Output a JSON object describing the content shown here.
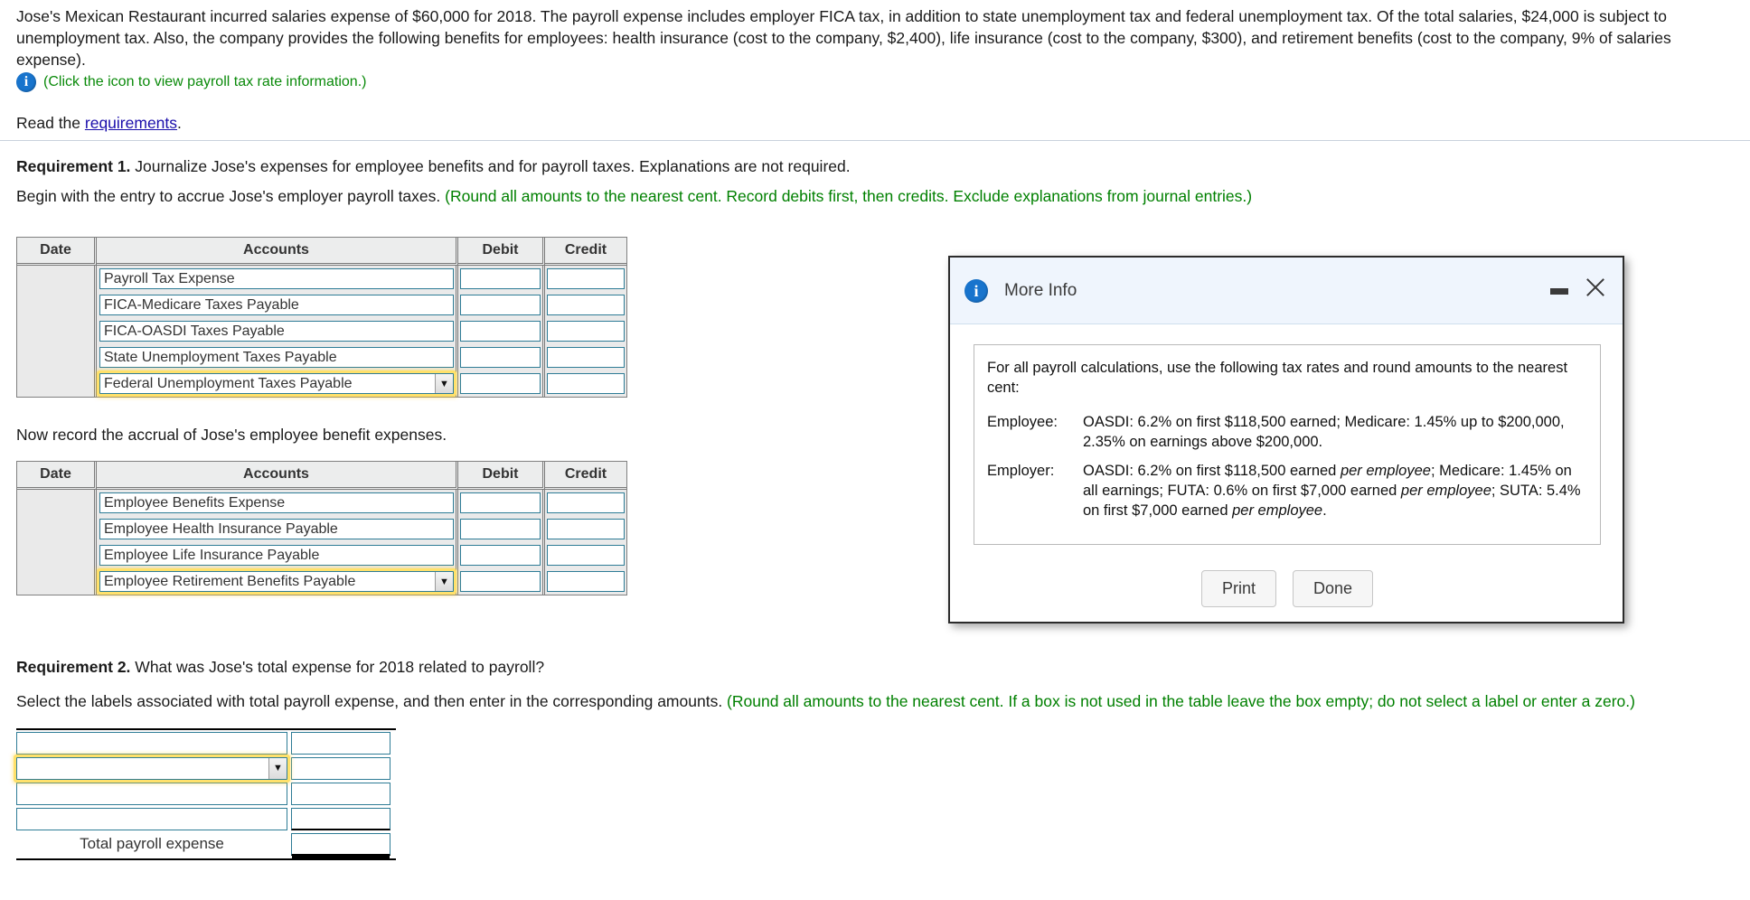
{
  "intro": {
    "paragraph": "Jose's Mexican Restaurant incurred salaries expense of $60,000 for 2018. The payroll expense includes employer FICA tax, in addition to state unemployment tax and federal unemployment tax. Of the total salaries, $24,000 is subject to unemployment tax. Also, the company provides the following benefits for employees: health insurance (cost to the company, $2,400), life insurance (cost to the company, $300), and retirement benefits (cost to the company, 9% of salaries expense).",
    "icon_note": "(Click the icon to view payroll tax rate information.)",
    "info_icon": "info-icon",
    "read_prefix": "Read the ",
    "read_link": "requirements",
    "read_suffix": "."
  },
  "requirement1": {
    "label": "Requirement 1.",
    "text": " Journalize Jose's expenses for employee benefits and for payroll taxes. Explanations are not required.",
    "instruction_black": "Begin with the entry to accrue Jose's employer payroll taxes. ",
    "instruction_green": "(Round all amounts to the nearest cent. Record debits first, then credits. Exclude explanations from journal entries.)",
    "second_instruction": "Now record the accrual of Jose's employee benefit expenses."
  },
  "journal_headers": {
    "date": "Date",
    "accounts": "Accounts",
    "debit": "Debit",
    "credit": "Credit"
  },
  "journal1": {
    "rows": [
      {
        "account": "Payroll Tax Expense",
        "debit": "",
        "credit": "",
        "type": "text",
        "focused": false
      },
      {
        "account": "FICA-Medicare Taxes Payable",
        "debit": "",
        "credit": "",
        "type": "text",
        "focused": false
      },
      {
        "account": "FICA-OASDI Taxes Payable",
        "debit": "",
        "credit": "",
        "type": "text",
        "focused": false
      },
      {
        "account": "State Unemployment Taxes Payable",
        "debit": "",
        "credit": "",
        "type": "text",
        "focused": false
      },
      {
        "account": "Federal Unemployment Taxes Payable",
        "debit": "",
        "credit": "",
        "type": "select",
        "focused": true
      }
    ]
  },
  "journal2": {
    "rows": [
      {
        "account": "Employee Benefits Expense",
        "debit": "",
        "credit": "",
        "type": "text",
        "focused": false
      },
      {
        "account": "Employee Health Insurance Payable",
        "debit": "",
        "credit": "",
        "type": "text",
        "focused": false
      },
      {
        "account": "Employee Life Insurance Payable",
        "debit": "",
        "credit": "",
        "type": "text",
        "focused": false
      },
      {
        "account": "Employee Retirement Benefits Payable",
        "debit": "",
        "credit": "",
        "type": "select",
        "focused": true
      }
    ]
  },
  "requirement2": {
    "label": "Requirement 2.",
    "text": " What was Jose's total expense for 2018 related to payroll?",
    "instruction_black": "Select the labels associated with total payroll expense, and then enter in the corresponding amounts. ",
    "instruction_green": "(Round all amounts to the nearest cent. If a box is not used in the table leave the box empty; do not select a label or enter a zero.)",
    "rows": [
      {
        "label": "",
        "amount": "",
        "type": "text",
        "focused": false,
        "rule": "none"
      },
      {
        "label": "",
        "amount": "",
        "type": "select",
        "focused": true,
        "rule": "none"
      },
      {
        "label": "",
        "amount": "",
        "type": "text",
        "focused": false,
        "rule": "none"
      },
      {
        "label": "",
        "amount": "",
        "type": "text",
        "focused": false,
        "rule": "single"
      }
    ],
    "total_label": "Total payroll expense",
    "total_amount": ""
  },
  "modal": {
    "title": "More Info",
    "info_icon": "info-icon",
    "minimize_icon": "minimize-icon",
    "close_icon": "close-icon",
    "lead": "For all payroll calculations, use the following tax rates and round amounts to the nearest cent:",
    "rates": [
      {
        "key": "Employee:",
        "parts": [
          {
            "text": "OASDI: 6.2% on first $118,500 earned; Medicare: 1.45% up to $200,000, 2.35% on earnings above $200,000.",
            "italic": false
          }
        ]
      },
      {
        "key": "Employer:",
        "parts": [
          {
            "text": "OASDI: 6.2% on first $118,500 earned ",
            "italic": false
          },
          {
            "text": "per employee",
            "italic": true
          },
          {
            "text": "; Medicare: 1.45% on all earnings; FUTA: 0.6% on first $7,000 earned ",
            "italic": false
          },
          {
            "text": "per employee",
            "italic": true
          },
          {
            "text": "; SUTA: 5.4% on first $7,000 earned ",
            "italic": false
          },
          {
            "text": "per employee",
            "italic": true
          },
          {
            "text": ".",
            "italic": false
          }
        ]
      }
    ],
    "print_label": "Print",
    "done_label": "Done"
  },
  "colors": {
    "link": "#1a0dab",
    "green": "#008000",
    "accent_blue": "#1874cd",
    "field_border": "#2e7c96",
    "focus_yellow": "#ffe16b"
  }
}
